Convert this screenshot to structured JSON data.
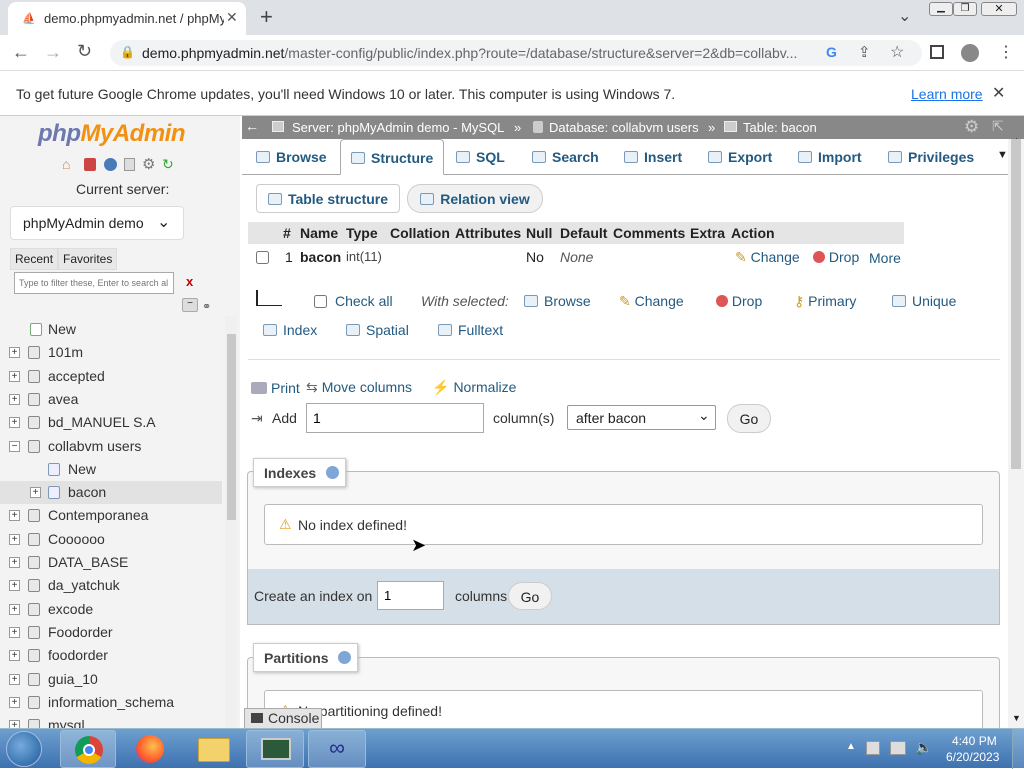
{
  "browser": {
    "tab_title": "demo.phpmyadmin.net / phpMy",
    "url_host": "demo.phpmyadmin.net",
    "url_path": "/master-config/public/index.php?route=/database/structure&server=2&db=collabv..."
  },
  "infobar": {
    "message": "To get future Google Chrome updates, you'll need Windows 10 or later. This computer is using Windows 7.",
    "learn_more": "Learn more"
  },
  "nav": {
    "logo_php": "php",
    "logo_my": "MyAdmin",
    "current_server_label": "Current server:",
    "server_select": "phpMyAdmin demo - ",
    "recent": "Recent",
    "favorites": "Favorites",
    "filter_placeholder": "Type to filter these, Enter to search al",
    "filter_clear": "x",
    "items": [
      {
        "label": "New",
        "kind": "new"
      },
      {
        "label": "101m"
      },
      {
        "label": "accepted"
      },
      {
        "label": "avea"
      },
      {
        "label": "bd_MANUEL S.A"
      },
      {
        "label": "collabvm users",
        "expanded": true
      },
      {
        "label": "New",
        "kind": "subnew"
      },
      {
        "label": "bacon",
        "kind": "table"
      },
      {
        "label": "Contemporanea"
      },
      {
        "label": "Coooooo"
      },
      {
        "label": "DATA_BASE"
      },
      {
        "label": "da_yatchuk"
      },
      {
        "label": "excode"
      },
      {
        "label": "Foodorder"
      },
      {
        "label": "foodorder"
      },
      {
        "label": "guia_10"
      },
      {
        "label": "information_schema"
      },
      {
        "label": "mysql"
      }
    ]
  },
  "breadcrumb": {
    "server": "Server: phpMyAdmin demo - MySQL",
    "sep": "»",
    "database": "Database: collabvm users",
    "table": "Table: bacon"
  },
  "tabs": [
    "Browse",
    "Structure",
    "SQL",
    "Search",
    "Insert",
    "Export",
    "Import",
    "Privileges"
  ],
  "subtabs": {
    "structure": "Table structure",
    "relation": "Relation view"
  },
  "columns": {
    "headers": [
      "#",
      "Name",
      "Type",
      "Collation",
      "Attributes",
      "Null",
      "Default",
      "Comments",
      "Extra",
      "Action"
    ],
    "rows": [
      {
        "num": "1",
        "name": "bacon",
        "type": "int(11)",
        "collation": "",
        "attributes": "",
        "null": "No",
        "default": "None",
        "comments": "",
        "extra": "",
        "change": "Change",
        "drop": "Drop",
        "more": "More"
      }
    ]
  },
  "bulk": {
    "check_all": "Check all",
    "with_selected": "With selected:",
    "actions": [
      "Browse",
      "Change",
      "Drop",
      "Primary",
      "Unique",
      "Index",
      "Spatial",
      "Fulltext"
    ]
  },
  "tools": {
    "print": "Print",
    "move": "Move columns",
    "normalize": "Normalize"
  },
  "add": {
    "label": "Add",
    "count": "1",
    "unit": "column(s)",
    "position": "after bacon",
    "go": "Go"
  },
  "indexes": {
    "title": "Indexes",
    "notice": "No index defined!",
    "create_label": "Create an index on",
    "create_count": "1",
    "columns_label": "columns",
    "go": "Go"
  },
  "partitions": {
    "title": "Partitions",
    "notice": "No partitioning defined!"
  },
  "console": "Console",
  "taskbar": {
    "time": "4:40 PM",
    "date": "6/20/2023"
  }
}
